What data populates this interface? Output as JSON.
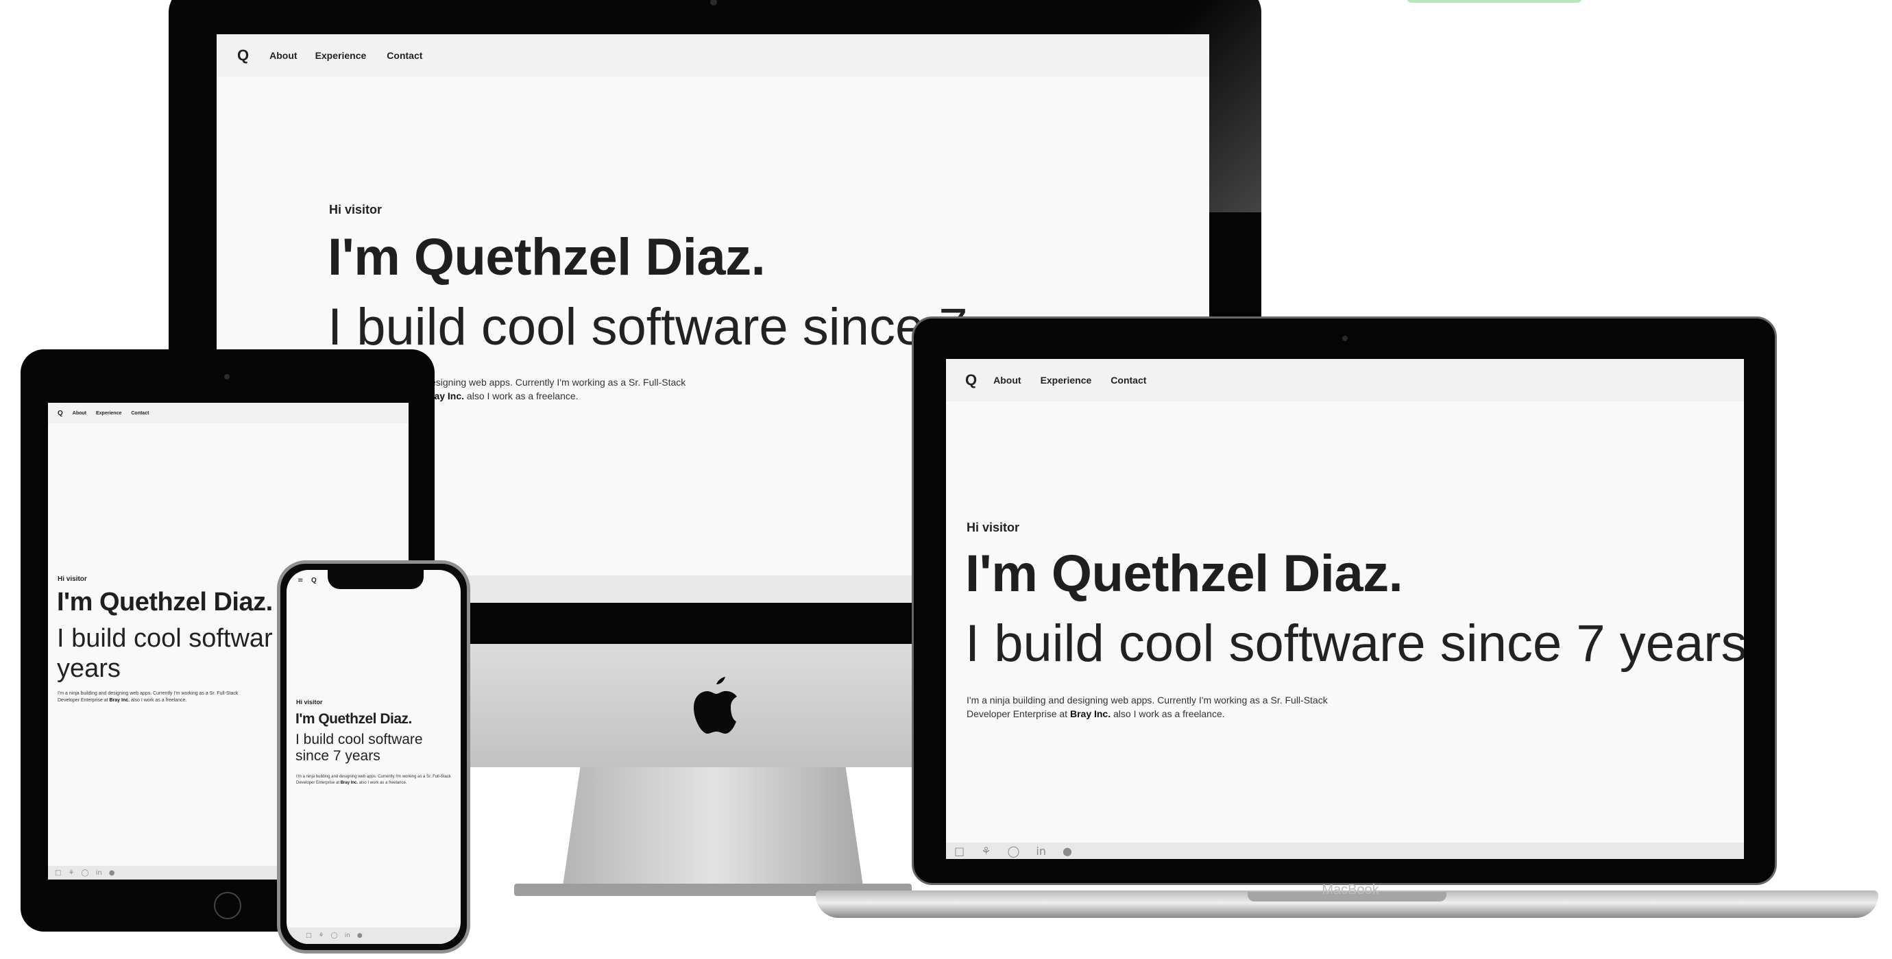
{
  "site": {
    "logo": "Q",
    "nav": [
      "About",
      "Experience",
      "Contact"
    ],
    "greeting": "Hi visitor",
    "name": "I'm Quethzel Diaz.",
    "tagline": "I build cool software since 7 years",
    "imac_tagline_visible": "I build cool software since 7",
    "ipad_tagline_line1": "I build cool softwar",
    "tagline_line2": "years",
    "iphone_tagline_line1": "I build cool software",
    "iphone_tagline_line2": "since 7 years",
    "bio_line1": "I'm a ninja building and designing web apps. Currently I'm working as a Sr. Full-Stack",
    "bio_line2_prefix": "Developer Enterprise at",
    "bio_company": "Bray Inc.",
    "bio_line2_suffix": "also I work as a freelance.",
    "imac_bio_line1": "esigning web apps. Currently I'm working as a Sr. Full-Stack",
    "imac_bio_company": "ray Inc.",
    "social_icons": [
      "instagram-icon",
      "dribbble-icon",
      "github-icon",
      "linkedin-icon",
      "globe-icon"
    ]
  },
  "devices": {
    "macbook_label": "MacBook",
    "apple_logo": ""
  },
  "colors": {
    "screen_bg": "#f9f9f9",
    "nav_bg": "#f2f2f2",
    "text": "#222222",
    "device_black": "#050505",
    "accent_green": "#b8e6b8"
  }
}
